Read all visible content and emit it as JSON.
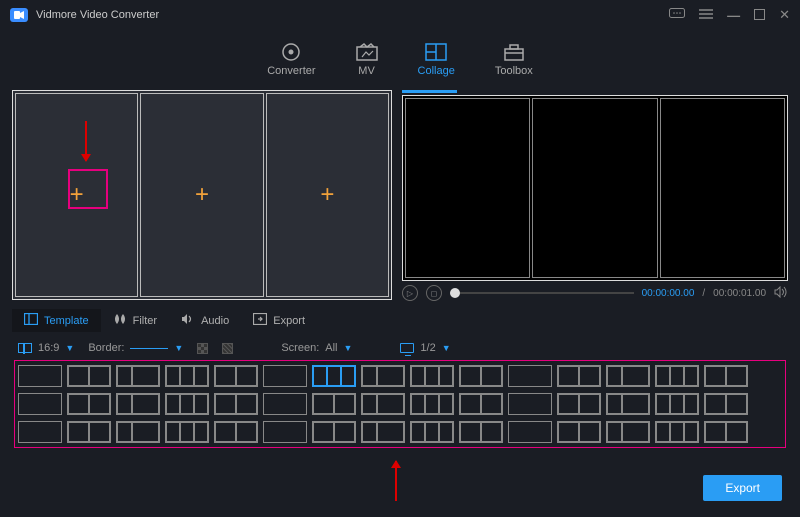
{
  "app": {
    "title": "Vidmore Video Converter"
  },
  "main_tabs": {
    "converter": "Converter",
    "mv": "MV",
    "collage": "Collage",
    "toolbox": "Toolbox",
    "active": "collage"
  },
  "sub_tabs": {
    "template": "Template",
    "filter": "Filter",
    "audio": "Audio",
    "export": "Export",
    "active": "template"
  },
  "player": {
    "current_time": "00:00:00.00",
    "total_time": "00:00:01.00"
  },
  "options": {
    "aspect_ratio": "16:9",
    "border_label": "Border:",
    "screen_label": "Screen:",
    "screen_value": "All",
    "display_value": "1/2"
  },
  "actions": {
    "export": "Export"
  },
  "template_count": 45,
  "selected_template_index": 6
}
